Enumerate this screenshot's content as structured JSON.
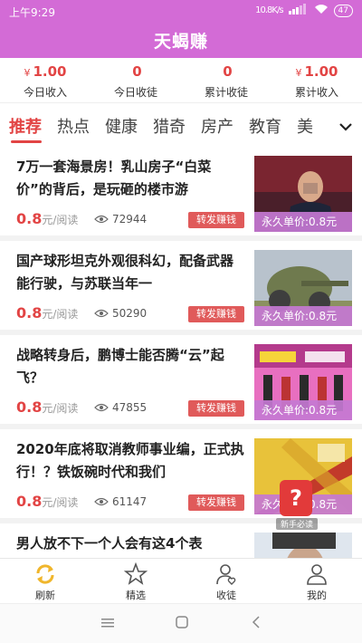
{
  "status_bar": {
    "time": "上午9:29",
    "network_speed": "10.8K/s",
    "battery": "47"
  },
  "app": {
    "title": "天蝎赚"
  },
  "stats": [
    {
      "value": "1.00",
      "currency": "¥",
      "label": "今日收入"
    },
    {
      "value": "0",
      "currency": "",
      "label": "今日收徒"
    },
    {
      "value": "0",
      "currency": "",
      "label": "累计收徒"
    },
    {
      "value": "1.00",
      "currency": "¥",
      "label": "累计收入"
    }
  ],
  "tabs": [
    "推荐",
    "热点",
    "健康",
    "猎奇",
    "房产",
    "教育",
    "美"
  ],
  "articles": [
    {
      "title": "7万一套海景房！乳山房子“白菜价”的背后，是玩砸的楼市游",
      "price": "0.8",
      "price_unit": "元/阅读",
      "views": "72944",
      "share_label": "转发赚钱",
      "unit_price": "永久单价:0.8元"
    },
    {
      "title": "国产球形坦克外观很科幻，配备武器能行驶，与苏联当年一",
      "price": "0.8",
      "price_unit": "元/阅读",
      "views": "50290",
      "share_label": "转发赚钱",
      "unit_price": "永久单价:0.8元"
    },
    {
      "title": "战略转身后，鹏博士能否腾“云”起飞？",
      "price": "0.8",
      "price_unit": "元/阅读",
      "views": "47855",
      "share_label": "转发赚钱",
      "unit_price": "永久单价:0.8元"
    },
    {
      "title": "2020年底将取消教师事业编，正式执行！？铁饭碗时代和我们",
      "price": "0.8",
      "price_unit": "元/阅读",
      "views": "61147",
      "share_label": "转发赚钱",
      "unit_price": "永久单价:0.8元"
    },
    {
      "title": "男人放不下一个人会有这4个表",
      "price": "",
      "price_unit": "",
      "views": "",
      "share_label": "",
      "unit_price": ""
    }
  ],
  "floating_badge": {
    "glyph": "?",
    "caption": "新手必读"
  },
  "bottom_nav": [
    {
      "label": "刷新",
      "icon": "refresh-icon",
      "active": true
    },
    {
      "label": "精选",
      "icon": "star-icon",
      "active": false
    },
    {
      "label": "收徒",
      "icon": "apprentice-icon",
      "active": false
    },
    {
      "label": "我的",
      "icon": "profile-icon",
      "active": false
    }
  ],
  "colors": {
    "header": "#d36bd6",
    "accent_red": "#e24444",
    "share_button": "#e05a5a",
    "unit_overlay": "#c478d2"
  }
}
